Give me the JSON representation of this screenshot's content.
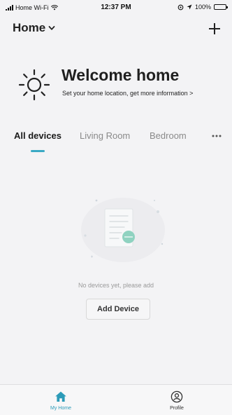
{
  "status_bar": {
    "carrier": "Home Wi-Fi",
    "time": "12:37 PM",
    "battery": "100%"
  },
  "header": {
    "home_label": "Home",
    "add_icon": "plus-icon"
  },
  "welcome": {
    "icon": "sun-icon",
    "title": "Welcome home",
    "subtitle": "Set your home location, get more information",
    "subtitle_arrow": ">"
  },
  "tabs": [
    {
      "label": "All devices",
      "active": true
    },
    {
      "label": "Living Room",
      "active": false
    },
    {
      "label": "Bedroom",
      "active": false
    }
  ],
  "more_icon": "more-dots-icon",
  "empty_state": {
    "illustration": "empty-devices-illustration",
    "message": "No devices yet, please add",
    "button_label": "Add Device"
  },
  "bottom_nav": [
    {
      "label": "My Home",
      "icon": "home-icon",
      "active": true
    },
    {
      "label": "Profile",
      "icon": "profile-icon",
      "active": false
    }
  ],
  "colors": {
    "accent": "#2c9bb8",
    "tab_indicator": "#3aa9c4",
    "background": "#f3f3f5"
  }
}
